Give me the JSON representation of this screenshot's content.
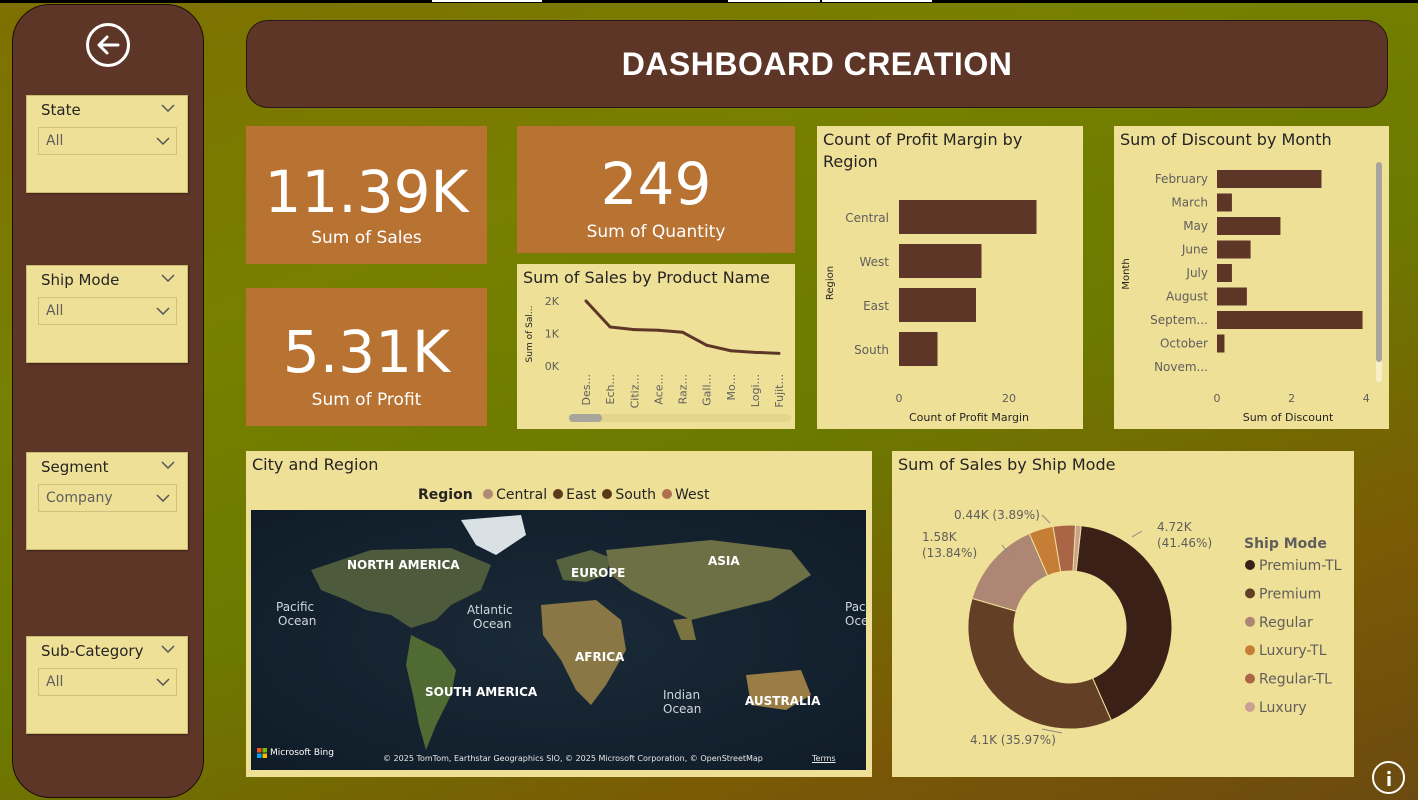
{
  "header": {
    "title": "DASHBOARD CREATION"
  },
  "slicers": [
    {
      "title": "State",
      "value": "All"
    },
    {
      "title": "Ship Mode",
      "value": "All"
    },
    {
      "title": "Segment",
      "value": "Company"
    },
    {
      "title": "Sub-Category",
      "value": "All"
    }
  ],
  "cards": {
    "sales": {
      "value": "11.39K",
      "label": "Sum of Sales"
    },
    "quantity": {
      "value": "249",
      "label": "Sum of Quantity"
    },
    "profit": {
      "value": "5.31K",
      "label": "Sum of Profit"
    }
  },
  "icons": {
    "back": "back-arrow-icon",
    "info": "info-icon",
    "chevron": "chevron-down-icon"
  },
  "colors": {
    "brown": "#5e3628",
    "card": "#b87333",
    "panel": "#efe097",
    "bar": "#5e3628"
  },
  "chart_data": [
    {
      "id": "product",
      "type": "line",
      "title": "Sum of Sales by Product Name",
      "ylabel": "Sum of Sal...",
      "categories": [
        "Des...",
        "Ech...",
        "Citiz...",
        "Ace...",
        "Raz...",
        "Gall...",
        "Mo...",
        "Logi...",
        "Fujit..."
      ],
      "values": [
        2000,
        1200,
        1120,
        1100,
        1040,
        640,
        470,
        420,
        390
      ],
      "yticks": [
        "0K",
        "1K",
        "2K"
      ],
      "ylim": [
        0,
        2000
      ]
    },
    {
      "id": "region",
      "type": "bar",
      "orientation": "horizontal",
      "title": "Count of Profit Margin by Region",
      "xlabel": "Count of Profit Margin",
      "ylabel": "Region",
      "categories": [
        "Central",
        "West",
        "East",
        "South"
      ],
      "values": [
        25,
        15,
        14,
        7
      ],
      "xticks": [
        "0",
        "20"
      ],
      "xlim": [
        0,
        28
      ]
    },
    {
      "id": "discount",
      "type": "bar",
      "orientation": "horizontal",
      "title": "Sum of Discount by Month",
      "xlabel": "Sum of Discount",
      "ylabel": "Month",
      "categories": [
        "February",
        "March",
        "May",
        "June",
        "July",
        "August",
        "Septem...",
        "October",
        "Novem..."
      ],
      "values": [
        2.8,
        0.4,
        1.7,
        0.9,
        0.4,
        0.8,
        3.9,
        0.2,
        0
      ],
      "xticks": [
        "0",
        "2",
        "4"
      ],
      "xlim": [
        0,
        4.1
      ]
    },
    {
      "id": "shipmode",
      "type": "pie",
      "variant": "donut",
      "title": "Sum of Sales by Ship Mode",
      "legend_title": "Ship Mode",
      "series": [
        {
          "name": "Premium-TL",
          "value": 4.72,
          "label": "4.72K (41.46%)",
          "color": "#3b2018"
        },
        {
          "name": "Premium",
          "value": 4.1,
          "label": "4.1K (35.97%)",
          "color": "#633f25"
        },
        {
          "name": "Regular",
          "value": 1.58,
          "label": "1.58K (13.84%)",
          "color": "#ad8773"
        },
        {
          "name": "Luxury-TL",
          "value": 0.44,
          "label": "0.44K (3.89%)",
          "color": "#c67d36"
        },
        {
          "name": "Regular-TL",
          "value": 0.4,
          "label": "",
          "color": "#a96546"
        },
        {
          "name": "Luxury",
          "value": 0.1,
          "label": "",
          "color": "#c9a193"
        }
      ]
    }
  ],
  "map": {
    "title": "City and Region",
    "legend_title": "Region",
    "legend": [
      {
        "name": "Central",
        "color": "#ae8a77"
      },
      {
        "name": "East",
        "color": "#5e3a1c"
      },
      {
        "name": "South",
        "color": "#5a3a16"
      },
      {
        "name": "West",
        "color": "#b07050"
      }
    ],
    "labels": {
      "na": "NORTH AMERICA",
      "eu": "EUROPE",
      "asia": "ASIA",
      "af": "AFRICA",
      "sa": "SOUTH AMERICA",
      "au": "AUSTRALIA",
      "pacific1": "Pacific",
      "pacific2": "Ocean",
      "atlantic1": "Atlantic",
      "atlantic2": "Ocean",
      "indian1": "Indian",
      "indian2": "Ocean",
      "pac_right1": "Pac",
      "pac_right2": "Oce"
    },
    "bing": "Microsoft Bing",
    "attribution": "© 2025 TomTom, Earthstar Geographics SIO, © 2025 Microsoft Corporation, © OpenStreetMap",
    "terms": "Terms"
  }
}
